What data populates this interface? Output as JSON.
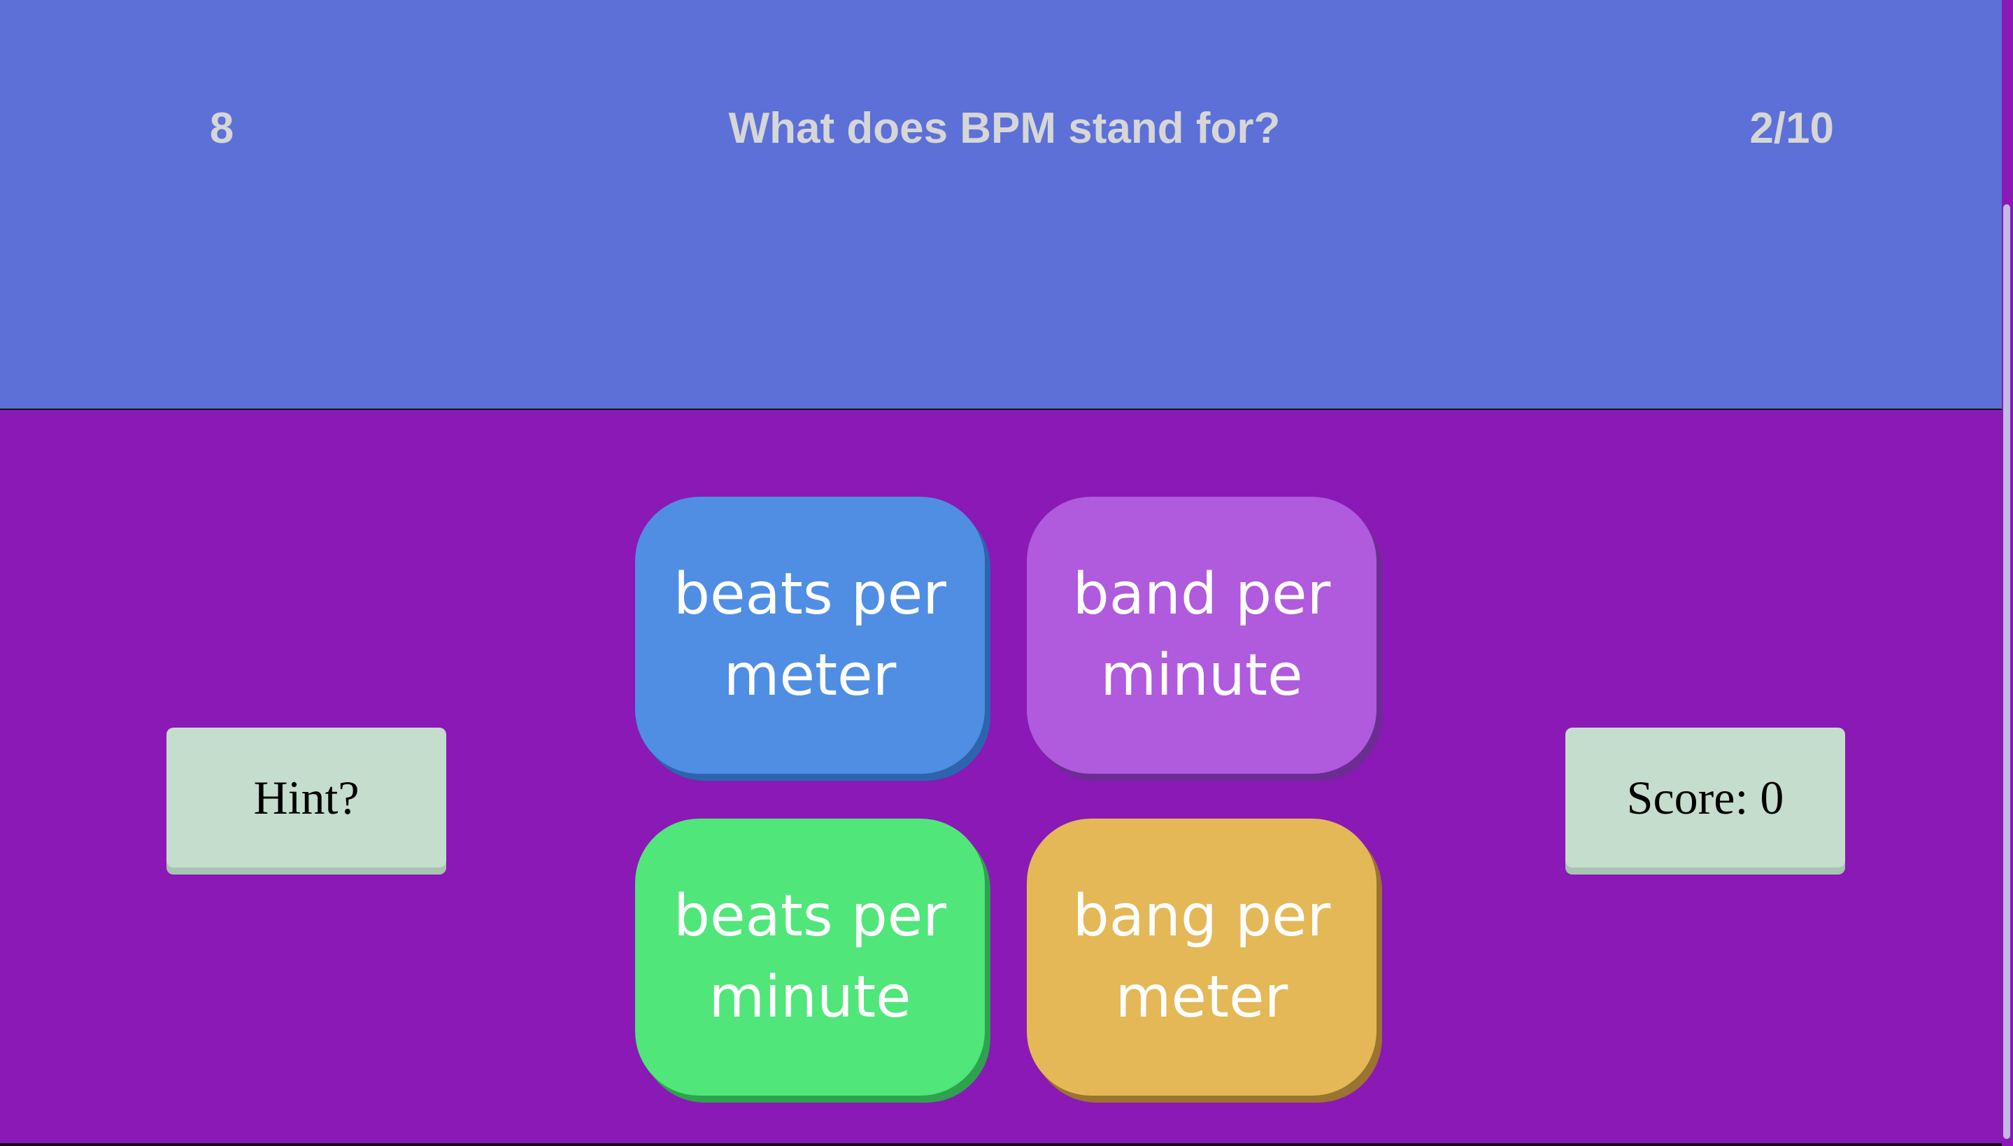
{
  "header": {
    "timer": "8",
    "question": "What does BPM stand for?",
    "progress": "2/10"
  },
  "answers": [
    {
      "label": "beats per meter"
    },
    {
      "label": "band per minute"
    },
    {
      "label": "beats per minute"
    },
    {
      "label": "bang per meter"
    }
  ],
  "controls": {
    "hint_label": "Hint?",
    "score_label": "Score: 0"
  },
  "colors": {
    "header_bg": "#5c70d8",
    "main_bg": "#8a19b6",
    "answer_blue": "#508ee4",
    "answer_purple": "#b05add",
    "answer_green": "#50e67a",
    "answer_gold": "#e4b856",
    "side_button_bg": "#c5ddcc"
  }
}
